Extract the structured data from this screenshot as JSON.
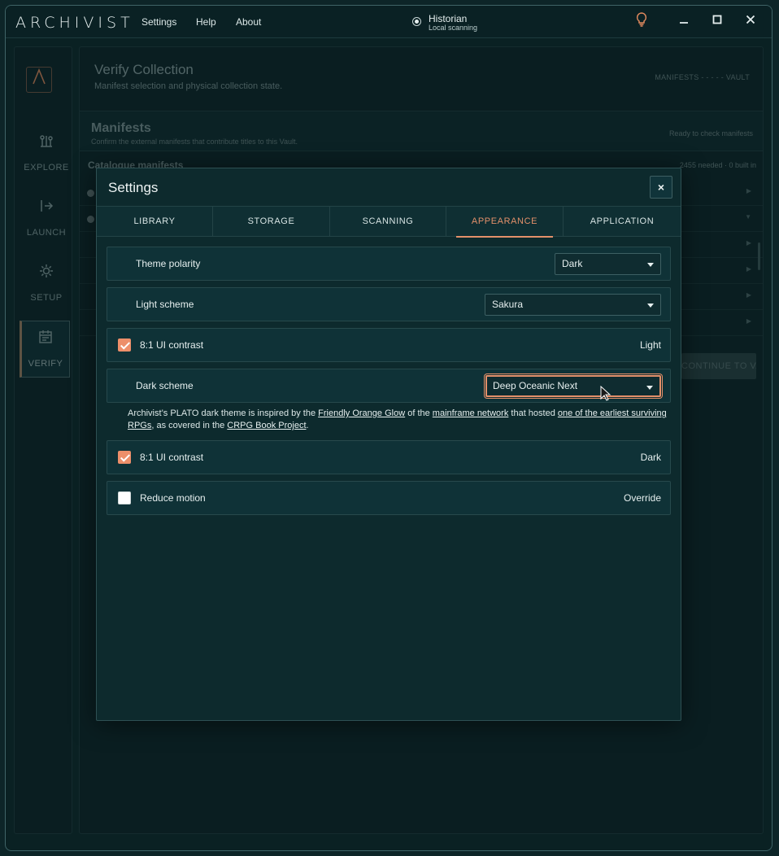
{
  "app": {
    "logo": "ARCHIVIST",
    "menu": [
      "Settings",
      "Help",
      "About"
    ],
    "profile": {
      "name": "Historian",
      "subtitle": "Local scanning"
    },
    "icons": [
      "lightbulb-icon",
      "minimize-icon",
      "maximize-icon",
      "close-icon"
    ]
  },
  "sidebar": {
    "items": [
      {
        "label": "EXPLORE",
        "icon": "explore-icon"
      },
      {
        "label": "LAUNCH",
        "icon": "launch-icon"
      },
      {
        "label": "SETUP",
        "icon": "gear-icon"
      },
      {
        "label": "VERIFY",
        "icon": "calendar-icon"
      }
    ]
  },
  "background": {
    "title": "Verify Collection",
    "subtitle": "Manifest selection and physical collection state.",
    "steps": "MANIFESTS - - - - - VAULT",
    "manifests_title": "Manifests",
    "manifests_subtitle": "Confirm the external manifests that contribute titles to this Vault.",
    "manifests_status": "Ready to check manifests",
    "catalogue_title": "Catalogue manifests",
    "catalogue_count": "2455 needed · 0 built in",
    "continue_label": "CONTINUE TO VAULT"
  },
  "settings": {
    "title": "Settings",
    "close": "×",
    "tabs": [
      "LIBRARY",
      "STORAGE",
      "SCANNING",
      "APPEARANCE",
      "APPLICATION"
    ],
    "active_tab": "APPEARANCE",
    "theme_polarity": {
      "label": "Theme polarity",
      "value": "Dark"
    },
    "light_scheme": {
      "label": "Light scheme",
      "value": "Sakura"
    },
    "light_contrast": {
      "label": "8:1 UI contrast",
      "right": "Light",
      "checked": true
    },
    "dark_scheme": {
      "label": "Dark scheme",
      "value": "Deep Oceanic Next"
    },
    "description": {
      "t1": "Archivist’s PLATO dark theme is inspired by the ",
      "l1": "Friendly Orange Glow",
      "t2": " of the ",
      "l2": "mainframe network",
      "t3": " that hosted ",
      "l3": "one of the earliest surviving RPGs",
      "t4": ", as covered in the ",
      "l4": "CRPG Book Project",
      "t5": "."
    },
    "dark_contrast": {
      "label": "8:1 UI contrast",
      "right": "Dark",
      "checked": true
    },
    "reduce_motion": {
      "label": "Reduce motion",
      "right": "Override",
      "checked": false
    }
  },
  "colors": {
    "accent": "#e3906a",
    "panel": "#0f3237",
    "background": "#0d2528"
  }
}
